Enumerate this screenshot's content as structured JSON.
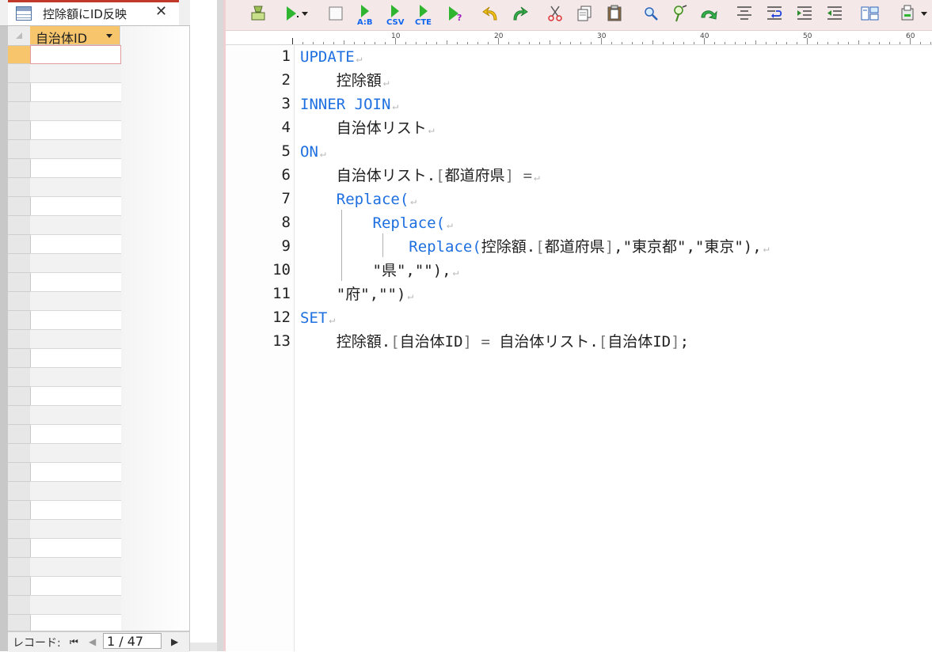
{
  "left_tab": {
    "title": "控除額にID反映",
    "close": "✕",
    "icon": "table-icon"
  },
  "datasheet": {
    "column_header": "自治体ID",
    "rows_visible": 31,
    "current_row": 1
  },
  "record_nav": {
    "label": "レコード:",
    "first": "⏮",
    "prev": "◀",
    "counter": "1 / 47",
    "next": "▶"
  },
  "toolbar": {
    "items": [
      "run-icon",
      "run-step-icon",
      "stop-icon",
      "ab-icon",
      "csv-icon",
      "cte-icon",
      "help-run-icon",
      "undo-icon",
      "redo-icon",
      "cut-icon",
      "copy-icon",
      "paste-icon",
      "search-icon",
      "find-replace-icon",
      "redo-arrow-icon",
      "align-icon",
      "wrap-icon",
      "indent-icon",
      "outdent-icon",
      "layout-icon",
      "settings-icon"
    ],
    "ab_text": "A:B",
    "csv_text": "CSV",
    "cte_text": "CTE"
  },
  "ruler": {
    "labels": [
      "10",
      "20",
      "30",
      "40",
      "50",
      "60"
    ]
  },
  "editor": {
    "line_numbers": [
      "1",
      "2",
      "3",
      "4",
      "5",
      "6",
      "7",
      "8",
      "9",
      "10",
      "11",
      "12",
      "13"
    ],
    "eol_mark": "↵",
    "lines": {
      "l1": "UPDATE",
      "l2": "    控除額",
      "l3": "INNER JOIN",
      "l4": "    自治体リスト",
      "l5": "ON",
      "l6_a": "    自治体リスト.",
      "l6_b": "[",
      "l6_c": "都道府県",
      "l6_d": "]",
      "l6_e": " =",
      "l7_a": "    ",
      "l7_b": "Replace(",
      "l8_a": "        ",
      "l8_b": "Replace(",
      "l9_a": "            ",
      "l9_b": "Replace(",
      "l9_c": "控除額.",
      "l9_d": "[",
      "l9_e": "都道府県",
      "l9_f": "]",
      "l9_g": ",\"東京都\",\"東京\"),",
      "l10": "        \"県\",\"\"),",
      "l11": "    \"府\",\"\")",
      "l12": "SET",
      "l13_a": "    控除額.",
      "l13_b": "[",
      "l13_c": "自治体ID",
      "l13_d": "]",
      "l13_e": " = ",
      "l13_f": "自治体リスト.",
      "l13_g": "[",
      "l13_h": "自治体ID",
      "l13_i": "]",
      "l13_j": ";"
    }
  }
}
